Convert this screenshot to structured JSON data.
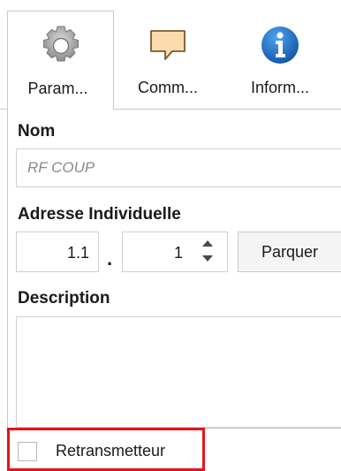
{
  "tabs": [
    {
      "label": "Param...",
      "icon": "gear-icon",
      "active": true
    },
    {
      "label": "Comm...",
      "icon": "comment-icon",
      "active": false
    },
    {
      "label": "Inform...",
      "icon": "info-icon",
      "active": false
    }
  ],
  "name_section": {
    "label": "Nom",
    "value": "RF COUP"
  },
  "address_section": {
    "label": "Adresse Individuelle",
    "part1": "1.1",
    "separator": ".",
    "part2": "1",
    "park_button": "Parquer"
  },
  "description_section": {
    "label": "Description",
    "value": ""
  },
  "retransmitter": {
    "label": "Retransmetteur",
    "checked": false
  },
  "colors": {
    "highlight": "#e8121b",
    "info_blue": "#1f6fc0",
    "comment_orange": "#f5c78a"
  }
}
